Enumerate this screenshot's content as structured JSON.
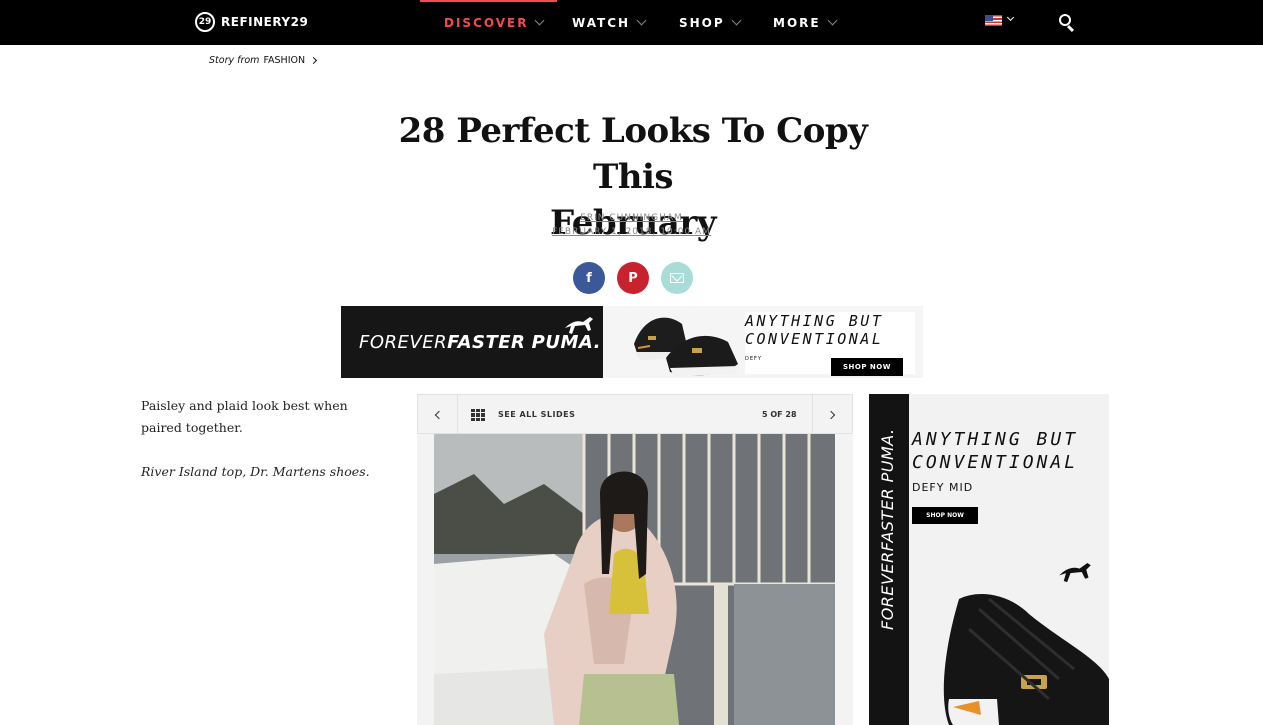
{
  "brand": {
    "logo_mark": "29",
    "name": "REFINERY29"
  },
  "nav": {
    "items": [
      {
        "label": "DISCOVER",
        "active": true
      },
      {
        "label": "WATCH",
        "active": false
      },
      {
        "label": "SHOP",
        "active": false
      },
      {
        "label": "MORE",
        "active": false
      }
    ],
    "region_icon": "us-flag-icon",
    "search_icon": "search-icon"
  },
  "breadcrumb": {
    "prefix": "Story from",
    "section": "FASHION"
  },
  "article": {
    "title_line1": "28 Perfect Looks To Copy This",
    "title_line2": "February",
    "author": "ERIN CUNNINGHAM",
    "date": "FEBRUARY 1, 2018, 10:00 AM"
  },
  "share": {
    "facebook_glyph": "f",
    "pinterest_glyph": "P",
    "email_icon": "mail-icon"
  },
  "banner_ad": {
    "tag_thin": "FOREVER",
    "tag_bold": "FASTER",
    "brand": "PUMA.",
    "headline_line1": "ANYTHING BUT",
    "headline_line2": "CONVENTIONAL",
    "product": "DEFY",
    "cta": "SHOP NOW"
  },
  "caption": {
    "text": "Paisley and plaid look best when paired together.",
    "credit": "River Island top, Dr. Martens shoes."
  },
  "slideshow": {
    "see_all_label": "SEE ALL SLIDES",
    "counter": "5 OF 28"
  },
  "side_ad": {
    "vertical_text": "FOREVERFASTER PUMA.",
    "headline_line1": "ANYTHING BUT",
    "headline_line2": "CONVENTIONAL",
    "product": "DEFY MID",
    "cta": "SHOP NOW"
  },
  "colors": {
    "nav_bg": "#000000",
    "accent": "#f04e4e",
    "facebook": "#3b5998",
    "pinterest": "#c8232c",
    "email": "#a7dcd8"
  }
}
